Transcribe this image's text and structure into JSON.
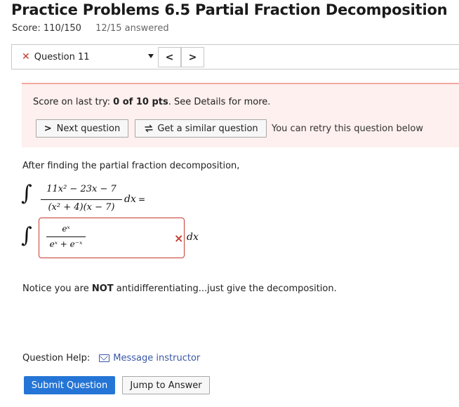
{
  "header": {
    "title": "Practice Problems 6.5 Partial Fraction Decomposition",
    "score": "Score: 110/150",
    "answered": "12/15 answered"
  },
  "nav": {
    "question_label": "Question 11",
    "prev_label": "<",
    "next_label": ">"
  },
  "alert": {
    "prefix": "Score on last try: ",
    "score": "0 of 10 pts",
    "suffix": ". See Details for more.",
    "next_button": "Next question",
    "similar_button": "Get a similar question",
    "retry_text": "You can retry this question below"
  },
  "problem": {
    "intro": "After finding the partial fraction decomposition,",
    "numerator": "11x² − 23x − 7",
    "denominator": "(x² + 4)(x − 7)",
    "dx": "dx",
    "equals": "=",
    "answer_numerator": "eˣ",
    "answer_denominator": "eˣ + e⁻ˣ",
    "answer_status": "×",
    "notice_prefix": "Notice you are ",
    "notice_bold": "NOT",
    "notice_suffix": " antidifferentiating...just give the decomposition."
  },
  "help": {
    "label": "Question Help:",
    "link": "Message instructor"
  },
  "actions": {
    "submit": "Submit Question",
    "jump": "Jump to Answer"
  },
  "colors": {
    "accent": "#2475d6",
    "error": "#c43b30",
    "link": "#3a57a7",
    "alert_bg": "#fdf0ee"
  }
}
